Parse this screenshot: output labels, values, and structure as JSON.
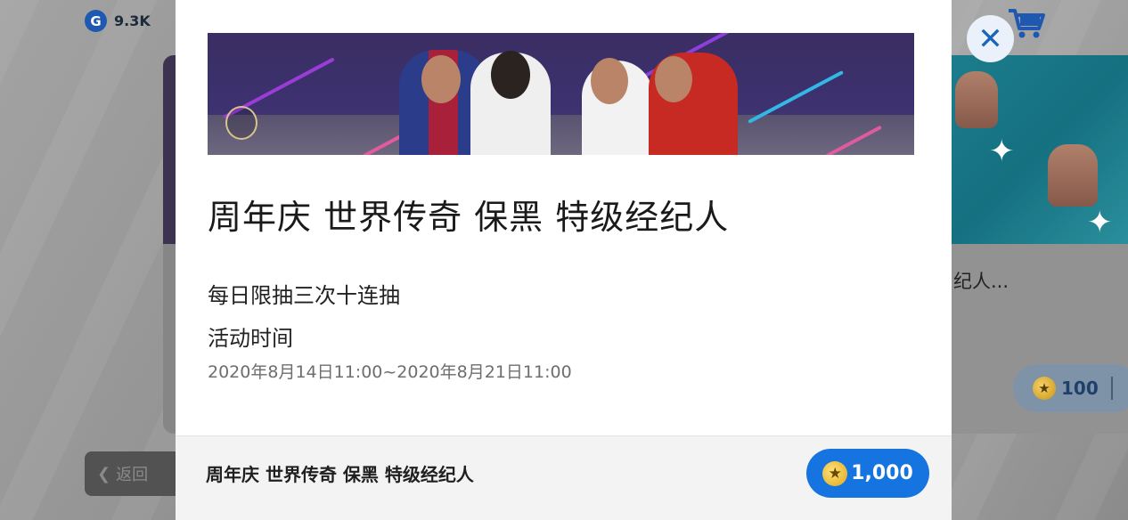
{
  "header": {
    "gp_icon": "G",
    "gp_value": "9.3K"
  },
  "background": {
    "right_card_name": "纪人...",
    "right_card_price": "100",
    "back_label": "返回"
  },
  "modal": {
    "title": "周年庆 世界传奇 保黑 特级经纪人",
    "description": "每日限抽三次十连抽",
    "period_label": "活动时间",
    "period_value": "2020年8月14日11:00~2020年8月21日11:00",
    "footer_name": "周年庆 世界传奇 保黑 特级经纪人",
    "price": "1,000",
    "close_glyph": "✕"
  },
  "icons": {
    "gp": "gp-coin-icon",
    "cart": "cart-icon",
    "coin": "coin-star-icon",
    "close": "close-icon",
    "back": "chevron-left-icon"
  },
  "colors": {
    "accent_blue": "#1574e0",
    "close_x": "#1a64b8",
    "coin_gold": "#e0a51a"
  }
}
